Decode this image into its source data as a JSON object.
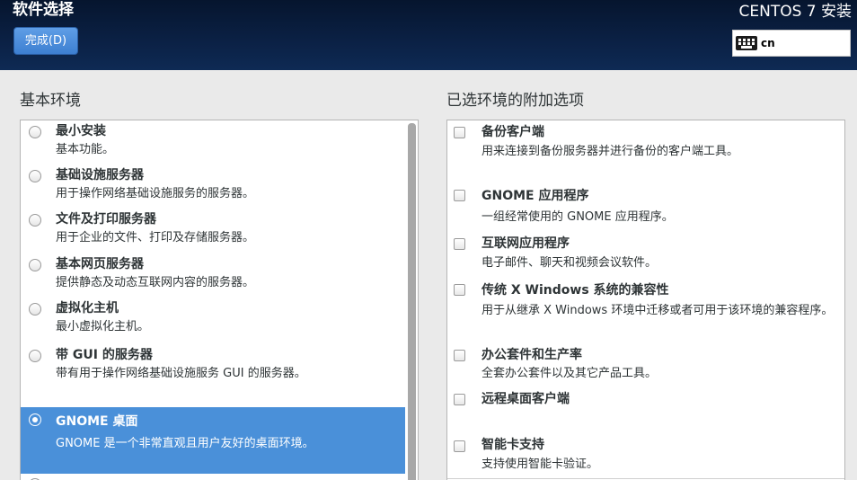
{
  "header": {
    "title": "软件选择",
    "done_button": "完成(D)",
    "product": "CENTOS 7 安装",
    "keyboard_layout": "cn"
  },
  "base_environment": {
    "heading": "基本环境",
    "items": [
      {
        "name": "最小安装",
        "desc": "基本功能。",
        "selected": false
      },
      {
        "name": "基础设施服务器",
        "desc": "用于操作网络基础设施服务的服务器。",
        "selected": false
      },
      {
        "name": "文件及打印服务器",
        "desc": "用于企业的文件、打印及存储服务器。",
        "selected": false
      },
      {
        "name": "基本网页服务器",
        "desc": "提供静态及动态互联网内容的服务器。",
        "selected": false
      },
      {
        "name": "虚拟化主机",
        "desc": "最小虚拟化主机。",
        "selected": false
      },
      {
        "name": "带 GUI 的服务器",
        "desc": "带有用于操作网络基础设施服务 GUI 的服务器。",
        "selected": false
      },
      {
        "name": "GNOME 桌面",
        "desc": "GNOME 是一个非常直观且用户友好的桌面环境。",
        "selected": true
      }
    ]
  },
  "addons": {
    "heading": "已选环境的附加选项",
    "items": [
      {
        "name": "备份客户端",
        "desc": "用来连接到备份服务器并进行备份的客户端工具。",
        "checked": false
      },
      {
        "name": "GNOME 应用程序",
        "desc": "一组经常使用的 GNOME 应用程序。",
        "checked": false
      },
      {
        "name": "互联网应用程序",
        "desc": "电子邮件、聊天和视频会议软件。",
        "checked": false
      },
      {
        "name": "传统 X Windows 系统的兼容性",
        "desc": "用于从继承 X Windows 环境中迁移或者可用于该环境的兼容程序。",
        "checked": false
      },
      {
        "name": "办公套件和生产率",
        "desc": "全套办公套件以及其它产品工具。",
        "checked": false
      },
      {
        "name": "远程桌面客户端",
        "desc": "",
        "checked": false
      },
      {
        "name": "智能卡支持",
        "desc": "支持使用智能卡验证。",
        "checked": false
      }
    ]
  },
  "colors": {
    "header_bg": "#0b2145",
    "accent": "#4a90d9",
    "page_bg": "#eaeaea"
  }
}
